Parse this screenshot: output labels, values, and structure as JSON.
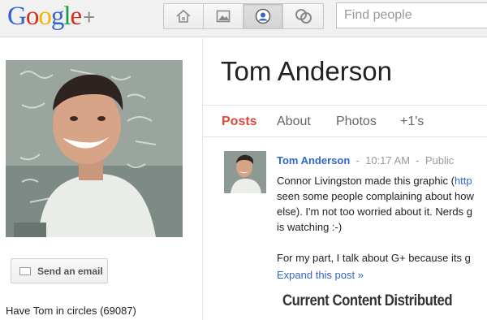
{
  "header": {
    "logo": {
      "letters": [
        "G",
        "o",
        "o",
        "g",
        "l",
        "e"
      ],
      "plus": "+"
    },
    "nav": [
      {
        "icon": "home-icon"
      },
      {
        "icon": "photos-icon"
      },
      {
        "icon": "profile-icon",
        "active": true
      },
      {
        "icon": "circles-icon"
      }
    ],
    "search": {
      "placeholder": "Find people"
    }
  },
  "profile": {
    "name": "Tom Anderson",
    "send_email_label": "Send an email",
    "in_circles_text": "Have Tom in circles (69087)"
  },
  "tabs": [
    {
      "label": "Posts",
      "active": true
    },
    {
      "label": "About"
    },
    {
      "label": "Photos"
    },
    {
      "label": "+1's"
    }
  ],
  "post": {
    "author": "Tom Anderson",
    "sep1": "-",
    "time": "10:17 AM",
    "sep2": "-",
    "visibility": "Public",
    "line1_text": "Connor Livingston made this graphic (",
    "line1_link": "http",
    "line2": "seen some people complaining about how",
    "line3": "else). I'm not too worried about it. Nerds g",
    "line4": "is watching :-)",
    "line6": "For my part, I talk about G+ because its g",
    "expand": "Expand this post »",
    "image_caption": "Current Content Distributed"
  },
  "colors": {
    "accent_red": "#dd4b39",
    "link_blue": "#3366cc",
    "topbar_bg": "#f1f1f1"
  }
}
